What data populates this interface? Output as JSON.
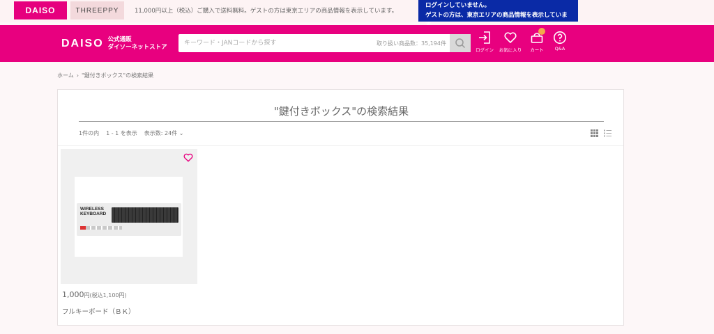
{
  "topbar": {
    "daiso_tab": "DAISO",
    "threeppy_tab": "THREEPPY",
    "shipping_note": "11,000円以上（税込）ご購入で送料無料。ゲストの方は東京エリアの商品情報を表示しています。",
    "login_notice_line1": "ログインしていません。",
    "login_notice_line2": "ゲストの方は、東京エリアの商品情報を表示しています。"
  },
  "header": {
    "logo_word": "DAISO",
    "logo_sub_line1": "公式通販",
    "logo_sub_line2": "ダイソーネットストア",
    "search_placeholder": "キーワード・JANコードから探す",
    "stock_count": "取り扱い商品数：35,194件",
    "login_label": "ログイン",
    "favorites_label": "お気に入り",
    "cart_label": "カート",
    "qa_label": "Q&A",
    "accent_color": "#e8007f"
  },
  "breadcrumb": {
    "home": "ホーム",
    "separator": "›",
    "current": "\"鍵付きボックス\"の検索結果"
  },
  "results": {
    "title": "\"鍵付きボックス\"の検索結果",
    "total": "1件の内",
    "range": "1 - 1 を表示",
    "per_page": "表示数: 24件 ⌄"
  },
  "products": [
    {
      "image_text": "WIRELESS\nKEYBOARD",
      "price": "1,000",
      "price_unit": "円",
      "price_tax": "(税込1,100円)",
      "name": "フルキーボード（ＢＫ）"
    }
  ]
}
